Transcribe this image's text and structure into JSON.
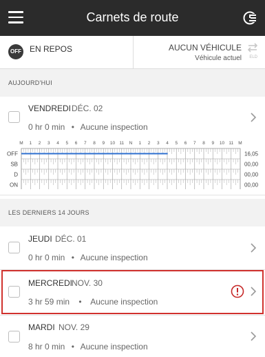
{
  "app_bar": {
    "title": "Carnets de route",
    "menu_icon": "hamburger-icon",
    "history_icon": "clock-list-icon"
  },
  "status": {
    "badge": "OFF",
    "duty_label": "EN REPOS",
    "vehicle_label": "AUCUN VÉHICULE",
    "vehicle_sub": "Véhicule actuel",
    "eld_label": "ELD",
    "swap_icon": "swap-arrows-icon"
  },
  "today_section": {
    "header": "AUJOURD'HUI",
    "day": {
      "name": "VENDREDI",
      "date": "DÉC. 02",
      "hours": "0 hr 0 min",
      "separator": "•",
      "inspection": "Aucune inspection"
    }
  },
  "graph": {
    "hour_labels": [
      "M",
      "1",
      "2",
      "3",
      "4",
      "5",
      "6",
      "7",
      "8",
      "9",
      "10",
      "11",
      "N",
      "1",
      "2",
      "3",
      "4",
      "5",
      "6",
      "7",
      "8",
      "9",
      "10",
      "11",
      "M"
    ],
    "status_rows": [
      {
        "label": "OFF",
        "total": "16,05"
      },
      {
        "label": "SB",
        "total": "00,00"
      },
      {
        "label": "D",
        "total": "00,00"
      },
      {
        "label": "ON",
        "total": "00,00"
      }
    ],
    "off_duty_until_hour": 16.05,
    "line_color": "#2d6fcf"
  },
  "past_section": {
    "header": "LES DERNIERS 14 JOURS",
    "days": [
      {
        "name": "JEUDI",
        "date": "DÉC. 01",
        "hours": "0 hr 0 min",
        "separator": "•",
        "inspection": "Aucune inspection",
        "warning": false
      },
      {
        "name": "MERCREDI",
        "date": "NOV. 30",
        "hours": "3 hr 59 min",
        "separator": "•",
        "inspection": "Aucune inspection",
        "warning": true
      },
      {
        "name": "MARDI",
        "date": "NOV. 29",
        "hours": "8 hr 0 min",
        "separator": "•",
        "inspection": "Aucune inspection",
        "warning": false
      }
    ]
  },
  "colors": {
    "app_bar": "#2b2b2b",
    "highlight": "#d0312d",
    "warning": "#c62828"
  }
}
